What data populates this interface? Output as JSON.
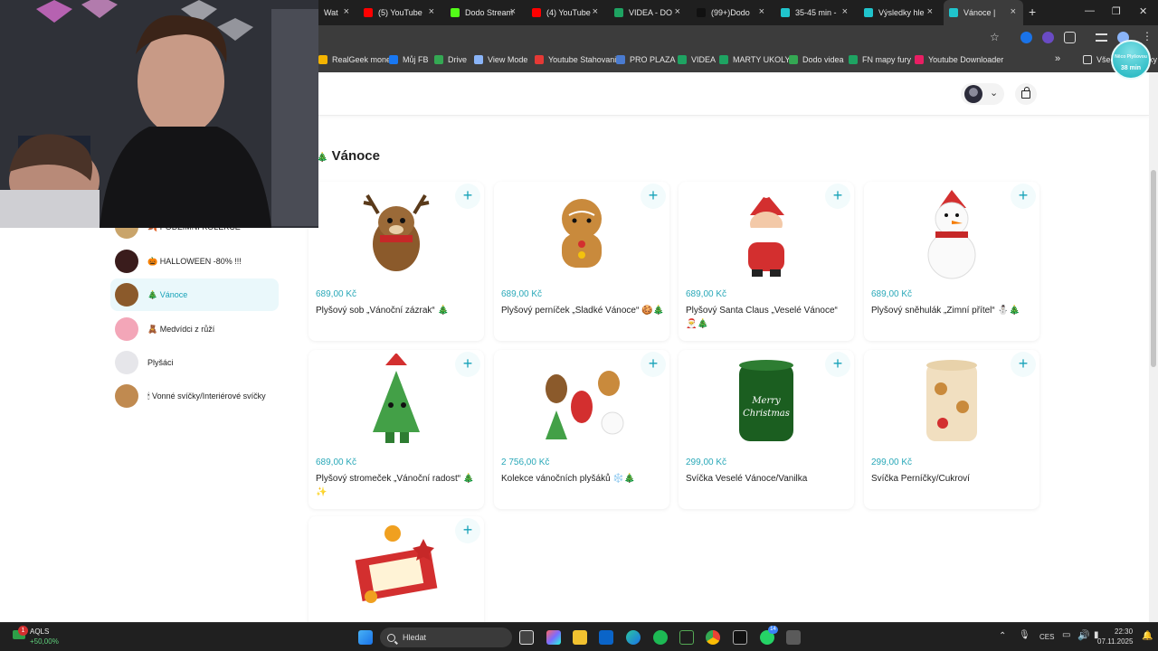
{
  "browser": {
    "tabs": [
      {
        "label": "Wat",
        "color": "#cc0000"
      },
      {
        "label": "(5) YouTube",
        "color": "#ff0000"
      },
      {
        "label": "Dodo Stream",
        "color": "#53fc18"
      },
      {
        "label": "(4) YouTube",
        "color": "#ff0000"
      },
      {
        "label": "VIDEA - DO",
        "color": "#1ea362"
      },
      {
        "label": "(99+)Dodo",
        "color": "#111111"
      },
      {
        "label": "35-45 min -",
        "color": "#20c4cc"
      },
      {
        "label": "Výsledky hle",
        "color": "#20c4cc"
      },
      {
        "label": "Vánoce |",
        "color": "#20c4cc"
      }
    ],
    "new_tab": "+",
    "close_glyph": "×"
  },
  "bookmarks": [
    {
      "label": "RealGeek money",
      "color": "#f4b400"
    },
    {
      "label": "Můj FB",
      "color": "#1877f2"
    },
    {
      "label": "Drive",
      "color": "#34a853"
    },
    {
      "label": "View Mode",
      "color": "#8ab4f8"
    },
    {
      "label": "Youtube Stahovani",
      "color": "#e53935"
    },
    {
      "label": "PRO PLAZA",
      "color": "#4a7bd0"
    },
    {
      "label": "VIDEA",
      "color": "#1ea362"
    },
    {
      "label": "MARTY UKOLY",
      "color": "#1ea362"
    },
    {
      "label": "Dodo videa",
      "color": "#34a853"
    },
    {
      "label": "FN mapy fury",
      "color": "#1ea362"
    },
    {
      "label": "Youtube Downloader",
      "color": "#e91e63"
    }
  ],
  "bookmarks_more": "»",
  "bookmarks_all": "Všechny záložky",
  "timer": {
    "top": "Něco Plyšovou",
    "time": "38 min"
  },
  "section_title": "Vánoce",
  "section_icon": "🎄",
  "sidebar": [
    {
      "label": "PODZIMNÍ KOLEKCE",
      "icon": "🍂",
      "active": false
    },
    {
      "label": "HALLOWEEN -80% !!!",
      "icon": "🎃",
      "active": false
    },
    {
      "label": "Vánoce",
      "icon": "🎄",
      "active": true
    },
    {
      "label": "Medvídci z růží",
      "icon": "🧸",
      "active": false
    },
    {
      "label": "Plyšáci",
      "icon": "",
      "active": false
    },
    {
      "label": "Vonné svíčky/Interiérové svíčky",
      "icon": "🕯",
      "active": false
    }
  ],
  "products": [
    {
      "price": "689,00 Kč",
      "name": "Plyšový sob „Vánoční zázrak“ 🎄"
    },
    {
      "price": "689,00 Kč",
      "name": "Plyšový perníček „Sladké Vánoce“ 🍪🎄"
    },
    {
      "price": "689,00 Kč",
      "name": "Plyšový Santa Claus „Veselé Vánoce“ 🎅🎄"
    },
    {
      "price": "689,00 Kč",
      "name": "Plyšový sněhulák „Zimní přítel“ ⛄🎄"
    },
    {
      "price": "689,00 Kč",
      "name": "Plyšový stromeček „Vánoční radost“ 🎄✨"
    },
    {
      "price": "2 756,00 Kč",
      "name": "Kolekce vánočních plyšáků ❄️🎄"
    },
    {
      "price": "299,00 Kč",
      "name": "Svíčka Veselé Vánoce/Vanilka"
    },
    {
      "price": "299,00 Kč",
      "name": "Svíčka Perníčky/Cukroví"
    },
    {
      "price": "",
      "name": ""
    }
  ],
  "add_glyph": "+",
  "taskbar": {
    "stock_name": "AQLS",
    "stock_change": "+50,00%",
    "stock_badge": "1",
    "search_placeholder": "Hledat",
    "lang": "CES",
    "time": "22:30",
    "date": "07.11.2025",
    "whatsapp_badge": "14"
  }
}
